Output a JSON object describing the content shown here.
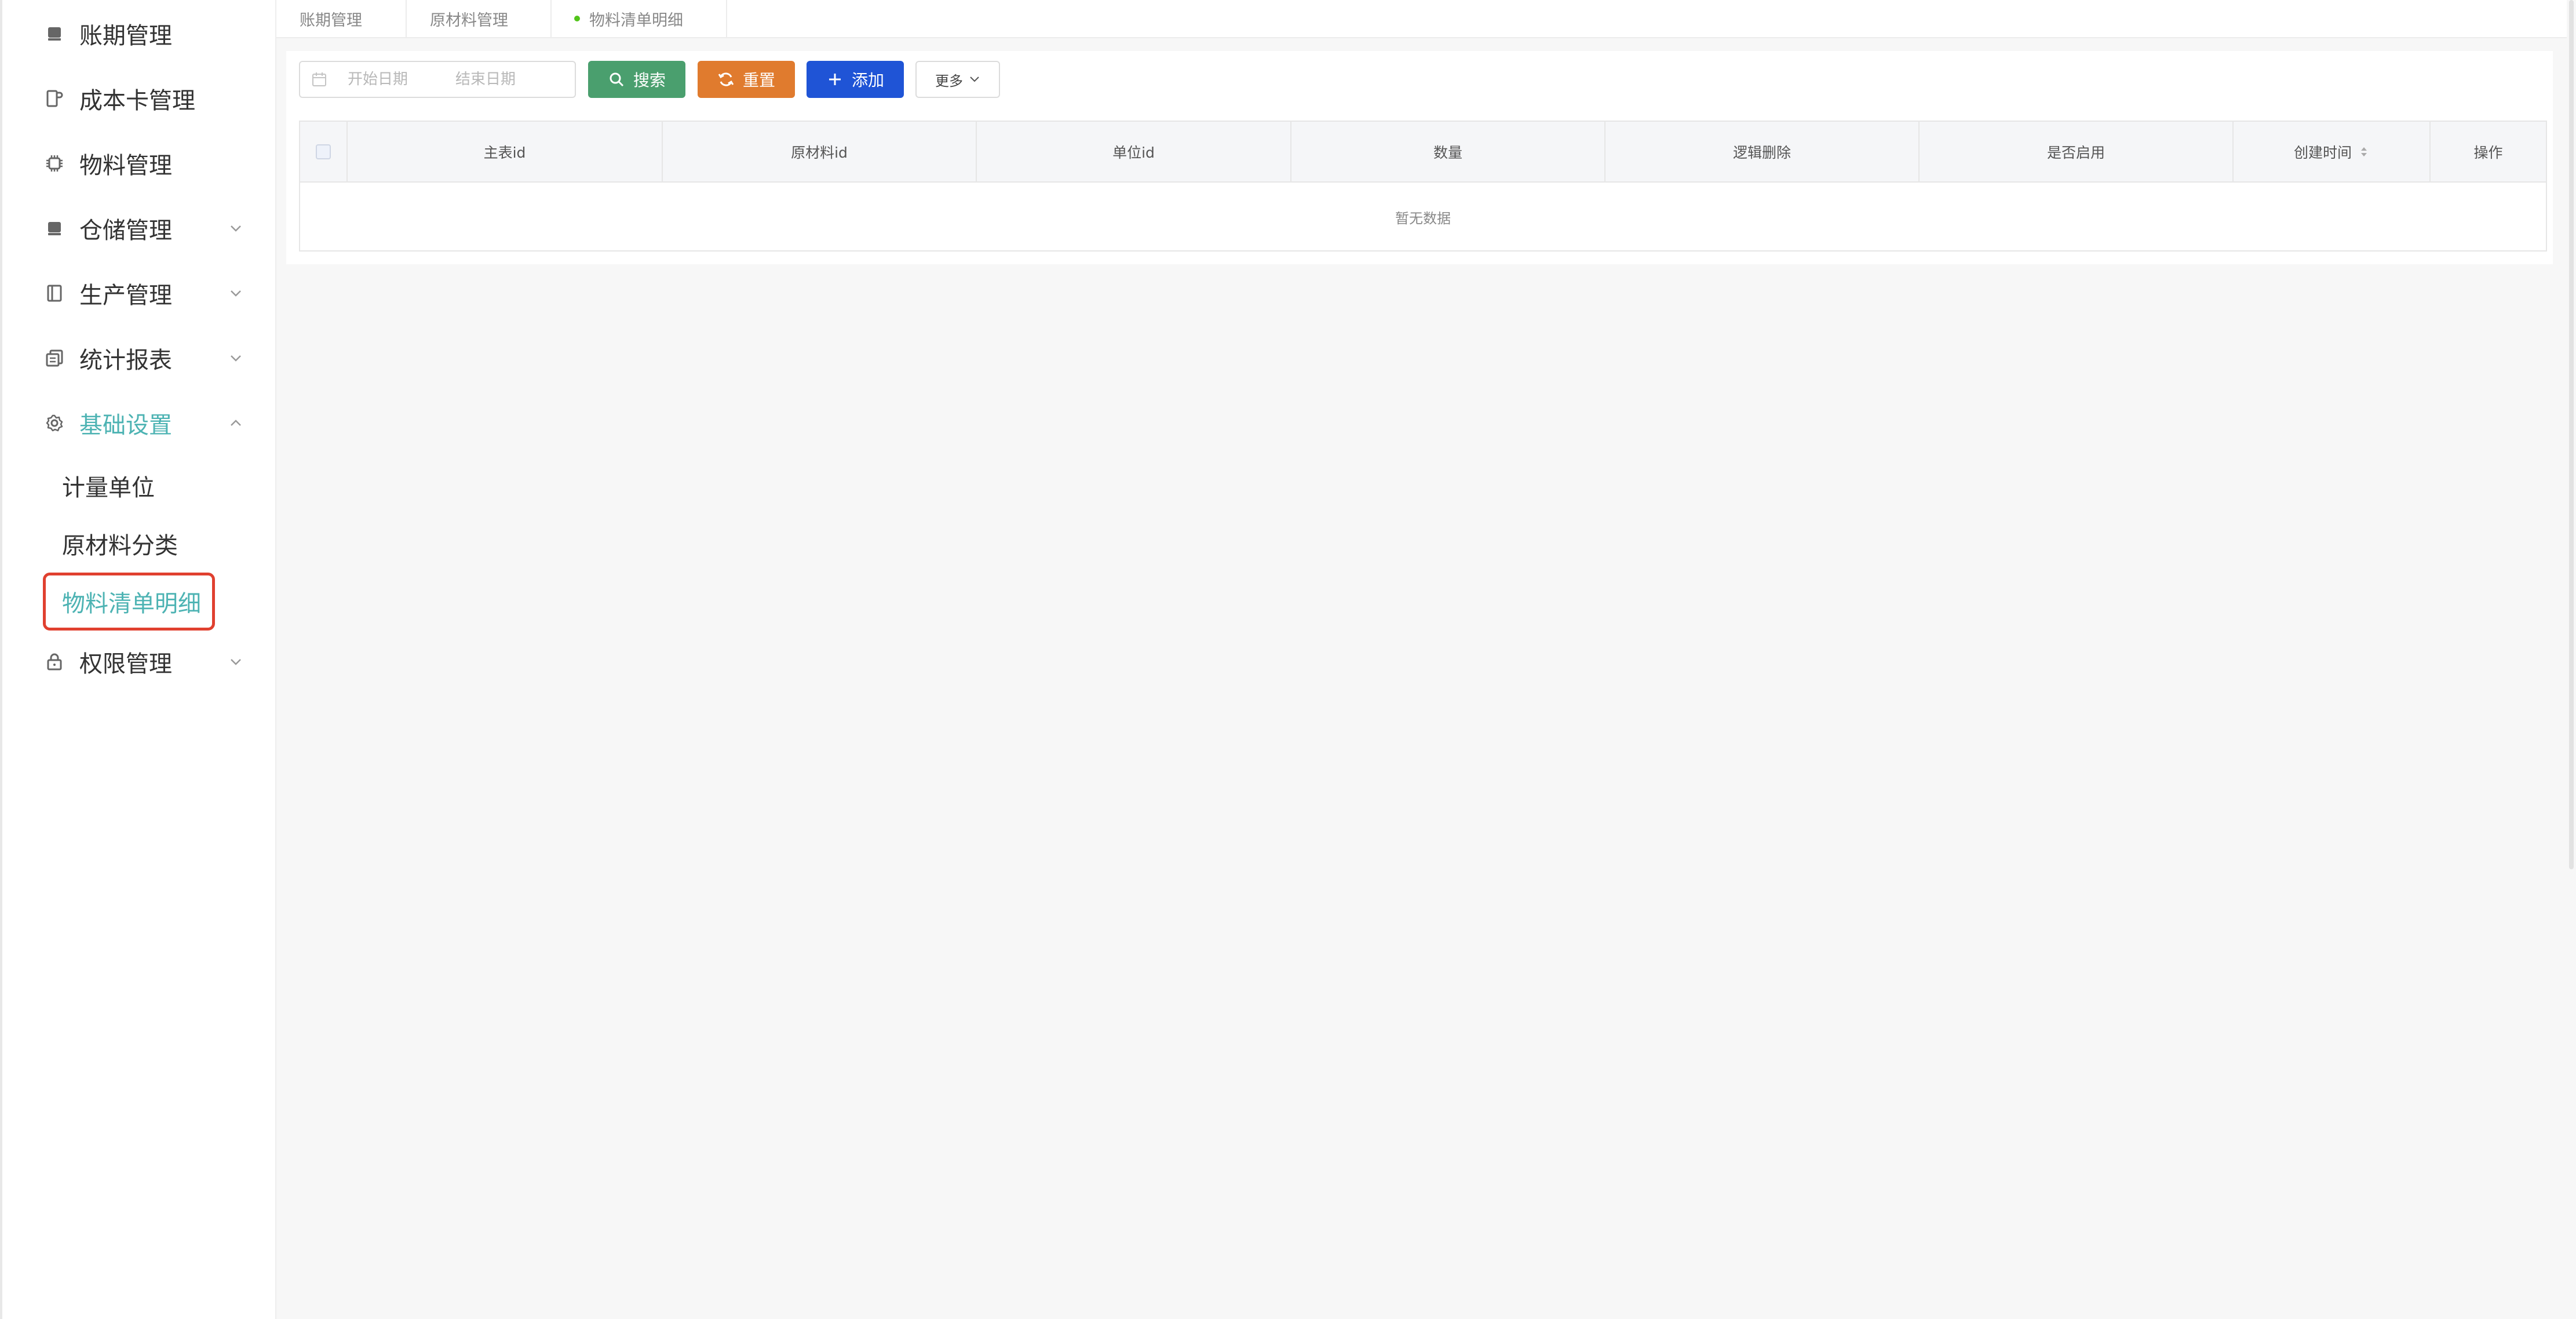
{
  "sidebar": {
    "items": [
      {
        "label": "账期管理",
        "icon": "wallet-icon",
        "has_chevron": false
      },
      {
        "label": "成本卡管理",
        "icon": "card-icon",
        "has_chevron": false
      },
      {
        "label": "物料管理",
        "icon": "chip-icon",
        "has_chevron": false
      },
      {
        "label": "仓储管理",
        "icon": "warehouse-icon",
        "has_chevron": true
      },
      {
        "label": "生产管理",
        "icon": "book-icon",
        "has_chevron": true
      },
      {
        "label": "统计报表",
        "icon": "report-icon",
        "has_chevron": true
      },
      {
        "label": "基础设置",
        "icon": "gear-icon",
        "has_chevron": true,
        "expanded": true
      },
      {
        "label": "权限管理",
        "icon": "lock-icon",
        "has_chevron": true
      }
    ],
    "submenu": [
      {
        "label": "计量单位"
      },
      {
        "label": "原材料分类"
      },
      {
        "label": "物料清单明细",
        "active": true
      }
    ]
  },
  "tabs": [
    {
      "label": "账期管理"
    },
    {
      "label": "原材料管理"
    },
    {
      "label": "物料清单明细",
      "active": true
    }
  ],
  "toolbar": {
    "start_placeholder": "开始日期",
    "end_placeholder": "结束日期",
    "search_label": "搜索",
    "reset_label": "重置",
    "add_label": "添加",
    "more_label": "更多"
  },
  "table": {
    "columns": [
      "主表id",
      "原材料id",
      "单位id",
      "数量",
      "逻辑删除",
      "是否启用",
      "创建时间",
      "操作"
    ],
    "sortable_column": "创建时间",
    "empty_text": "暂无数据"
  },
  "colors": {
    "accent": "#4db3b3",
    "search": "#4a9f6e",
    "reset": "#e07b2e",
    "add": "#1f54d6",
    "highlight_border": "#e0402f"
  }
}
